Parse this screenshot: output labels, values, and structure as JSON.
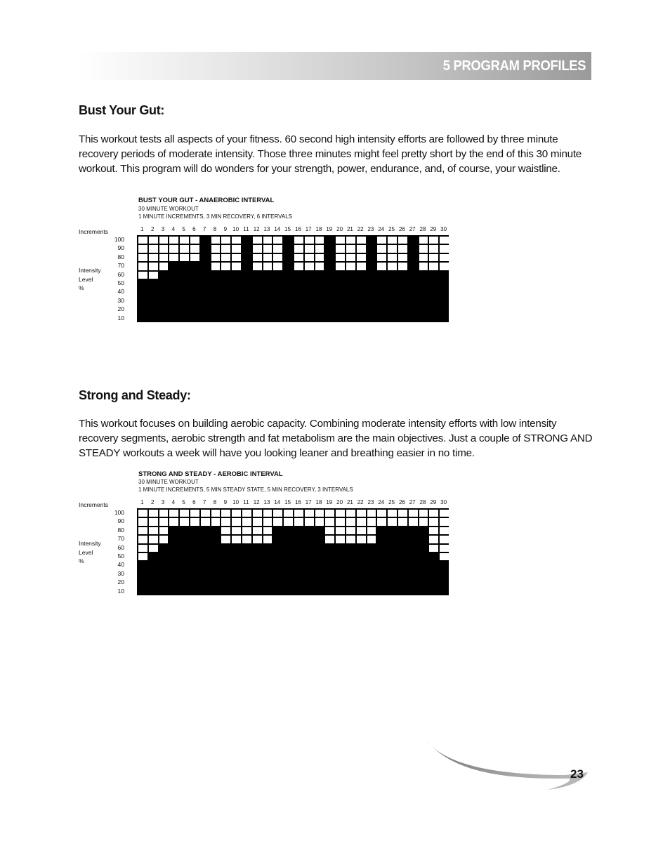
{
  "header": {
    "chapter_title": "5  PROGRAM PROFILES"
  },
  "sections": [
    {
      "title": "Bust Your Gut:",
      "body": "This workout tests all aspects of your fitness.  60 second high intensity efforts are followed by three minute recovery periods of moderate intensity.  Those three minutes might feel pretty short by the end of this 30 minute workout.  This program will do wonders for your strength, power, endurance, and, of course, your waistline."
    },
    {
      "title": "Strong and Steady:",
      "body": "This workout focuses on building aerobic capacity.  Combining moderate intensity efforts with low intensity recovery segments, aerobic strength and fat metabolism are the main objectives.  Just a couple of STRONG AND STEADY workouts a week will have you looking leaner and breathing easier in no time."
    }
  ],
  "axis_labels": {
    "increments": "Increments",
    "intensity": [
      "Intensity",
      "Level",
      "%"
    ]
  },
  "chart_data": [
    {
      "type": "bar",
      "title": "BUST YOUR GUT - ANAEROBIC INTERVAL",
      "subtitle_lines": [
        "30 MINUTE WORKOUT",
        "1 MINUTE INCREMENTS, 3 MIN RECOVERY, 6 INTERVALS"
      ],
      "xlabel": "Increments",
      "ylabel": "Intensity Level %",
      "categories": [
        "1",
        "2",
        "3",
        "4",
        "5",
        "6",
        "7",
        "8",
        "9",
        "10",
        "11",
        "12",
        "13",
        "14",
        "15",
        "16",
        "17",
        "18",
        "19",
        "20",
        "21",
        "22",
        "23",
        "24",
        "25",
        "26",
        "27",
        "28",
        "29",
        "30"
      ],
      "yticks": [
        "100",
        "90",
        "80",
        "70",
        "60",
        "50",
        "40",
        "30",
        "20",
        "10"
      ],
      "ylim": [
        0,
        100
      ],
      "values": [
        50,
        50,
        60,
        70,
        70,
        70,
        100,
        60,
        60,
        60,
        100,
        60,
        60,
        60,
        100,
        60,
        60,
        60,
        100,
        60,
        60,
        60,
        100,
        60,
        60,
        60,
        100,
        60,
        60,
        60
      ]
    },
    {
      "type": "bar",
      "title": "STRONG AND STEADY - AEROBIC INTERVAL",
      "subtitle_lines": [
        "30 MINUTE WORKOUT",
        "1 MINUTE INCREMENTS, 5 MIN STEADY STATE, 5 MIN RECOVERY, 3 INTERVALS"
      ],
      "xlabel": "Increments",
      "ylabel": "Intensity Level %",
      "categories": [
        "1",
        "2",
        "3",
        "4",
        "5",
        "6",
        "7",
        "8",
        "9",
        "10",
        "11",
        "12",
        "13",
        "14",
        "15",
        "16",
        "17",
        "18",
        "19",
        "20",
        "21",
        "22",
        "23",
        "24",
        "25",
        "26",
        "27",
        "28",
        "29",
        "30"
      ],
      "yticks": [
        "100",
        "90",
        "80",
        "70",
        "60",
        "50",
        "40",
        "30",
        "20",
        "10"
      ],
      "ylim": [
        0,
        100
      ],
      "values": [
        40,
        50,
        60,
        80,
        80,
        80,
        80,
        80,
        60,
        60,
        60,
        60,
        60,
        80,
        80,
        80,
        80,
        80,
        60,
        60,
        60,
        60,
        60,
        80,
        80,
        80,
        80,
        80,
        50,
        40
      ]
    }
  ],
  "footer": {
    "page_number": "23"
  }
}
